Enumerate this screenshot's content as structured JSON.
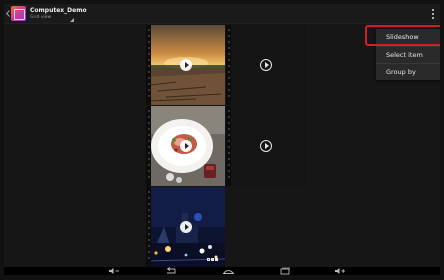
{
  "app": {
    "title": "Computex_Demo",
    "subtitle": "Grid view"
  },
  "overflow_menu": {
    "items": [
      {
        "label": "Slideshow",
        "highlighted": true
      },
      {
        "label": "Select item"
      },
      {
        "label": "Group by"
      }
    ],
    "highlight_color": "#d21f26"
  },
  "grid": {
    "tiles": [
      {
        "kind": "video",
        "subject": "sunset over field"
      },
      {
        "kind": "video",
        "subject": "dark placeholder"
      },
      {
        "kind": "video",
        "subject": "food plate"
      },
      {
        "kind": "video",
        "subject": "dark placeholder"
      },
      {
        "kind": "video",
        "subject": "night city lights"
      }
    ]
  },
  "navigation": {
    "icons": [
      "volume-down-icon",
      "back-icon",
      "home-icon",
      "recent-apps-icon",
      "volume-up-icon"
    ]
  }
}
